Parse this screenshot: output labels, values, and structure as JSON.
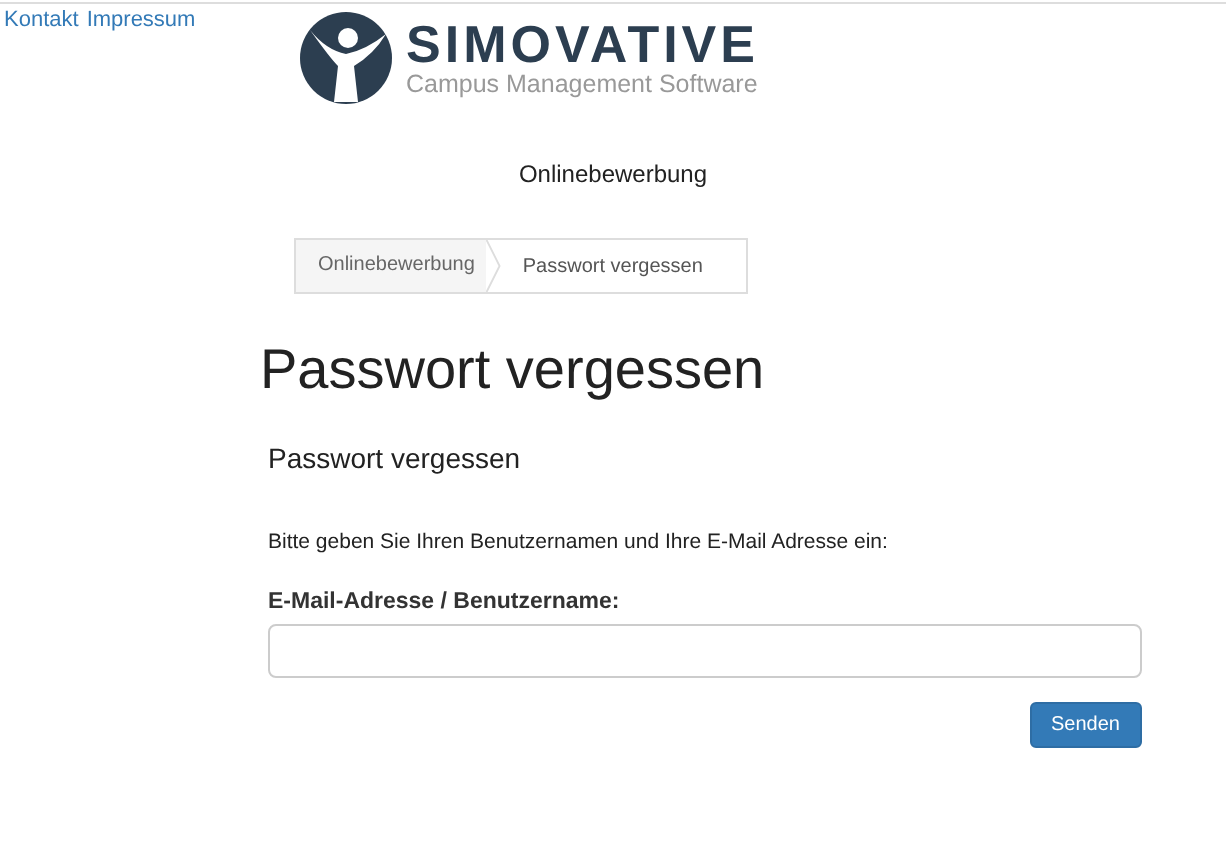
{
  "top_links": [
    "Kontakt",
    "Impressum"
  ],
  "logo": {
    "name": "SIMOVATIVE",
    "tagline": "Campus Management Software"
  },
  "app_title": "Onlinebewerbung",
  "breadcrumb": [
    {
      "label": "Onlinebewerbung",
      "selected": false
    },
    {
      "label": "Passwort vergessen",
      "selected": true
    }
  ],
  "heading": "Passwort vergessen",
  "subheading": "Passwort vergessen",
  "instructions": "Bitte geben Sie Ihren Benutzernamen und Ihre E-Mail Adresse ein:",
  "field": {
    "label": "E-Mail-Adresse / Benutzername:"
  },
  "button": "Senden"
}
